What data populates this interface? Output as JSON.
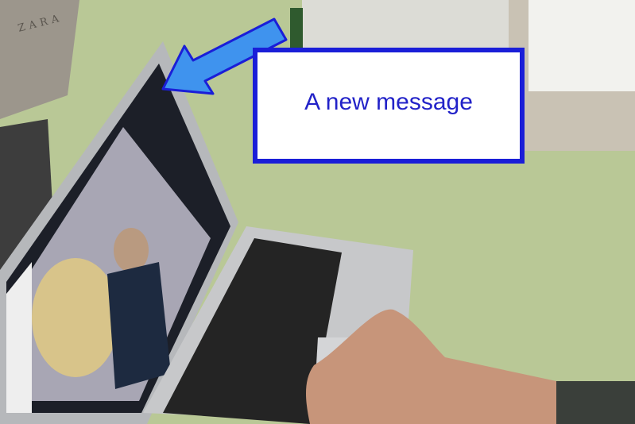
{
  "callout": {
    "text": "A new message",
    "border_color": "#1a1ed8",
    "text_color": "#2222c8"
  },
  "arrow": {
    "color": "#3f93ee",
    "outline_color": "#1a1ed8",
    "icon": "arrow-pointer-icon"
  },
  "scene": {
    "box_label": "ZARA",
    "desk_color": "#b9c896",
    "icons": [
      "laptop-icon",
      "keyboard-icon",
      "hand-icon",
      "video-call-icon"
    ]
  }
}
